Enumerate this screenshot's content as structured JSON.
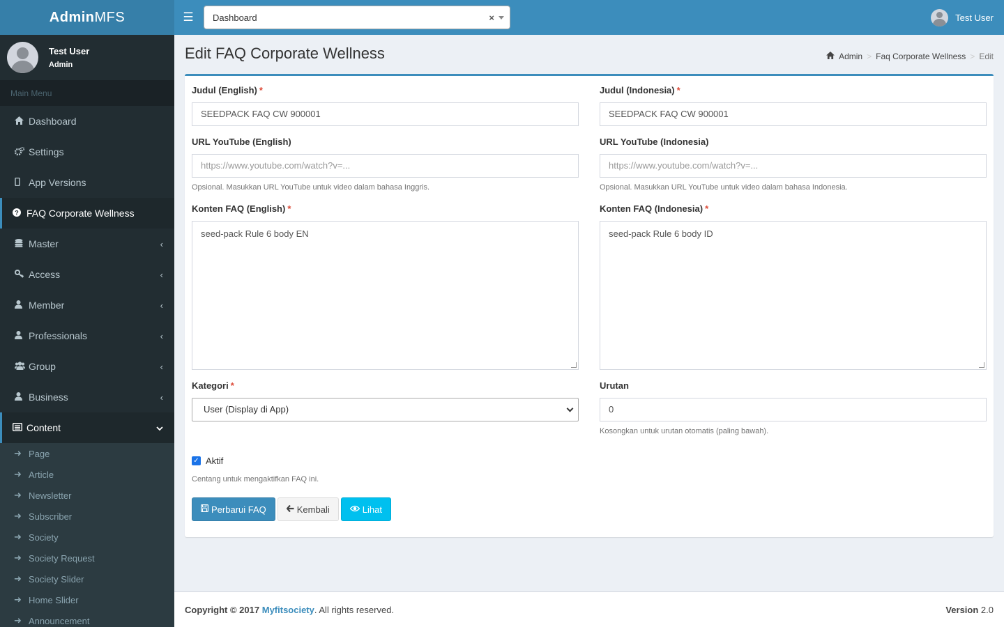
{
  "app": {
    "logo_bold": "Admin",
    "logo_light": "MFS"
  },
  "user": {
    "name": "Test User",
    "role": "Admin"
  },
  "sidebar": {
    "header": "Main Menu",
    "items": [
      {
        "label": "Dashboard",
        "icon": "home-icon"
      },
      {
        "label": "Settings",
        "icon": "gears-icon"
      },
      {
        "label": "App Versions",
        "icon": "mobile-icon"
      },
      {
        "label": "FAQ Corporate Wellness",
        "icon": "question-circle-icon"
      },
      {
        "label": "Master",
        "icon": "database-icon"
      },
      {
        "label": "Access",
        "icon": "key-icon"
      },
      {
        "label": "Member",
        "icon": "user-icon"
      },
      {
        "label": "Professionals",
        "icon": "user-icon"
      },
      {
        "label": "Group",
        "icon": "users-icon"
      },
      {
        "label": "Business",
        "icon": "user-icon"
      },
      {
        "label": "Content",
        "icon": "list-alt-icon"
      }
    ],
    "content_submenu": [
      "Page",
      "Article",
      "Newsletter",
      "Subscriber",
      "Society",
      "Society Request",
      "Society Slider",
      "Home Slider",
      "Announcement"
    ]
  },
  "topbar": {
    "select_value": "Dashboard",
    "clear": "×"
  },
  "page": {
    "title": "Edit FAQ Corporate Wellness"
  },
  "breadcrumb": {
    "home": "Admin",
    "section": "Faq Corporate Wellness",
    "current": "Edit"
  },
  "form": {
    "title_en_label": "Judul (English)",
    "title_en_value": "SEEDPACK FAQ CW 900001",
    "title_id_label": "Judul (Indonesia)",
    "title_id_value": "SEEDPACK FAQ CW 900001",
    "yt_en_label": "URL YouTube (English)",
    "yt_en_placeholder": "https://www.youtube.com/watch?v=...",
    "yt_en_help": "Opsional. Masukkan URL YouTube untuk video dalam bahasa Inggris.",
    "yt_id_label": "URL YouTube (Indonesia)",
    "yt_id_placeholder": "https://www.youtube.com/watch?v=...",
    "yt_id_help": "Opsional. Masukkan URL YouTube untuk video dalam bahasa Indonesia.",
    "content_en_label": "Konten FAQ (English)",
    "content_en_value": "seed-pack Rule 6 body EN",
    "content_id_label": "Konten FAQ (Indonesia)",
    "content_id_value": "seed-pack Rule 6 body ID",
    "category_label": "Kategori",
    "category_value": "User (Display di App)",
    "order_label": "Urutan",
    "order_value": "0",
    "order_help": "Kosongkan untuk urutan otomatis (paling bawah).",
    "active_label": "Aktif",
    "active_checked": true,
    "active_help": "Centang untuk mengaktifkan FAQ ini.",
    "required_mark": "*"
  },
  "buttons": {
    "update": "Perbarui FAQ",
    "back": "Kembali",
    "view": "Lihat"
  },
  "footer": {
    "copyright": "Copyright © 2017",
    "brand": "Myfitsociety",
    "rights": ". All rights reserved.",
    "version_label": "Version",
    "version_value": "2.0"
  },
  "colors": {
    "primary": "#3c8dbc",
    "sidebar": "#222d32",
    "info": "#00c0ef",
    "required": "#dd4b39"
  }
}
